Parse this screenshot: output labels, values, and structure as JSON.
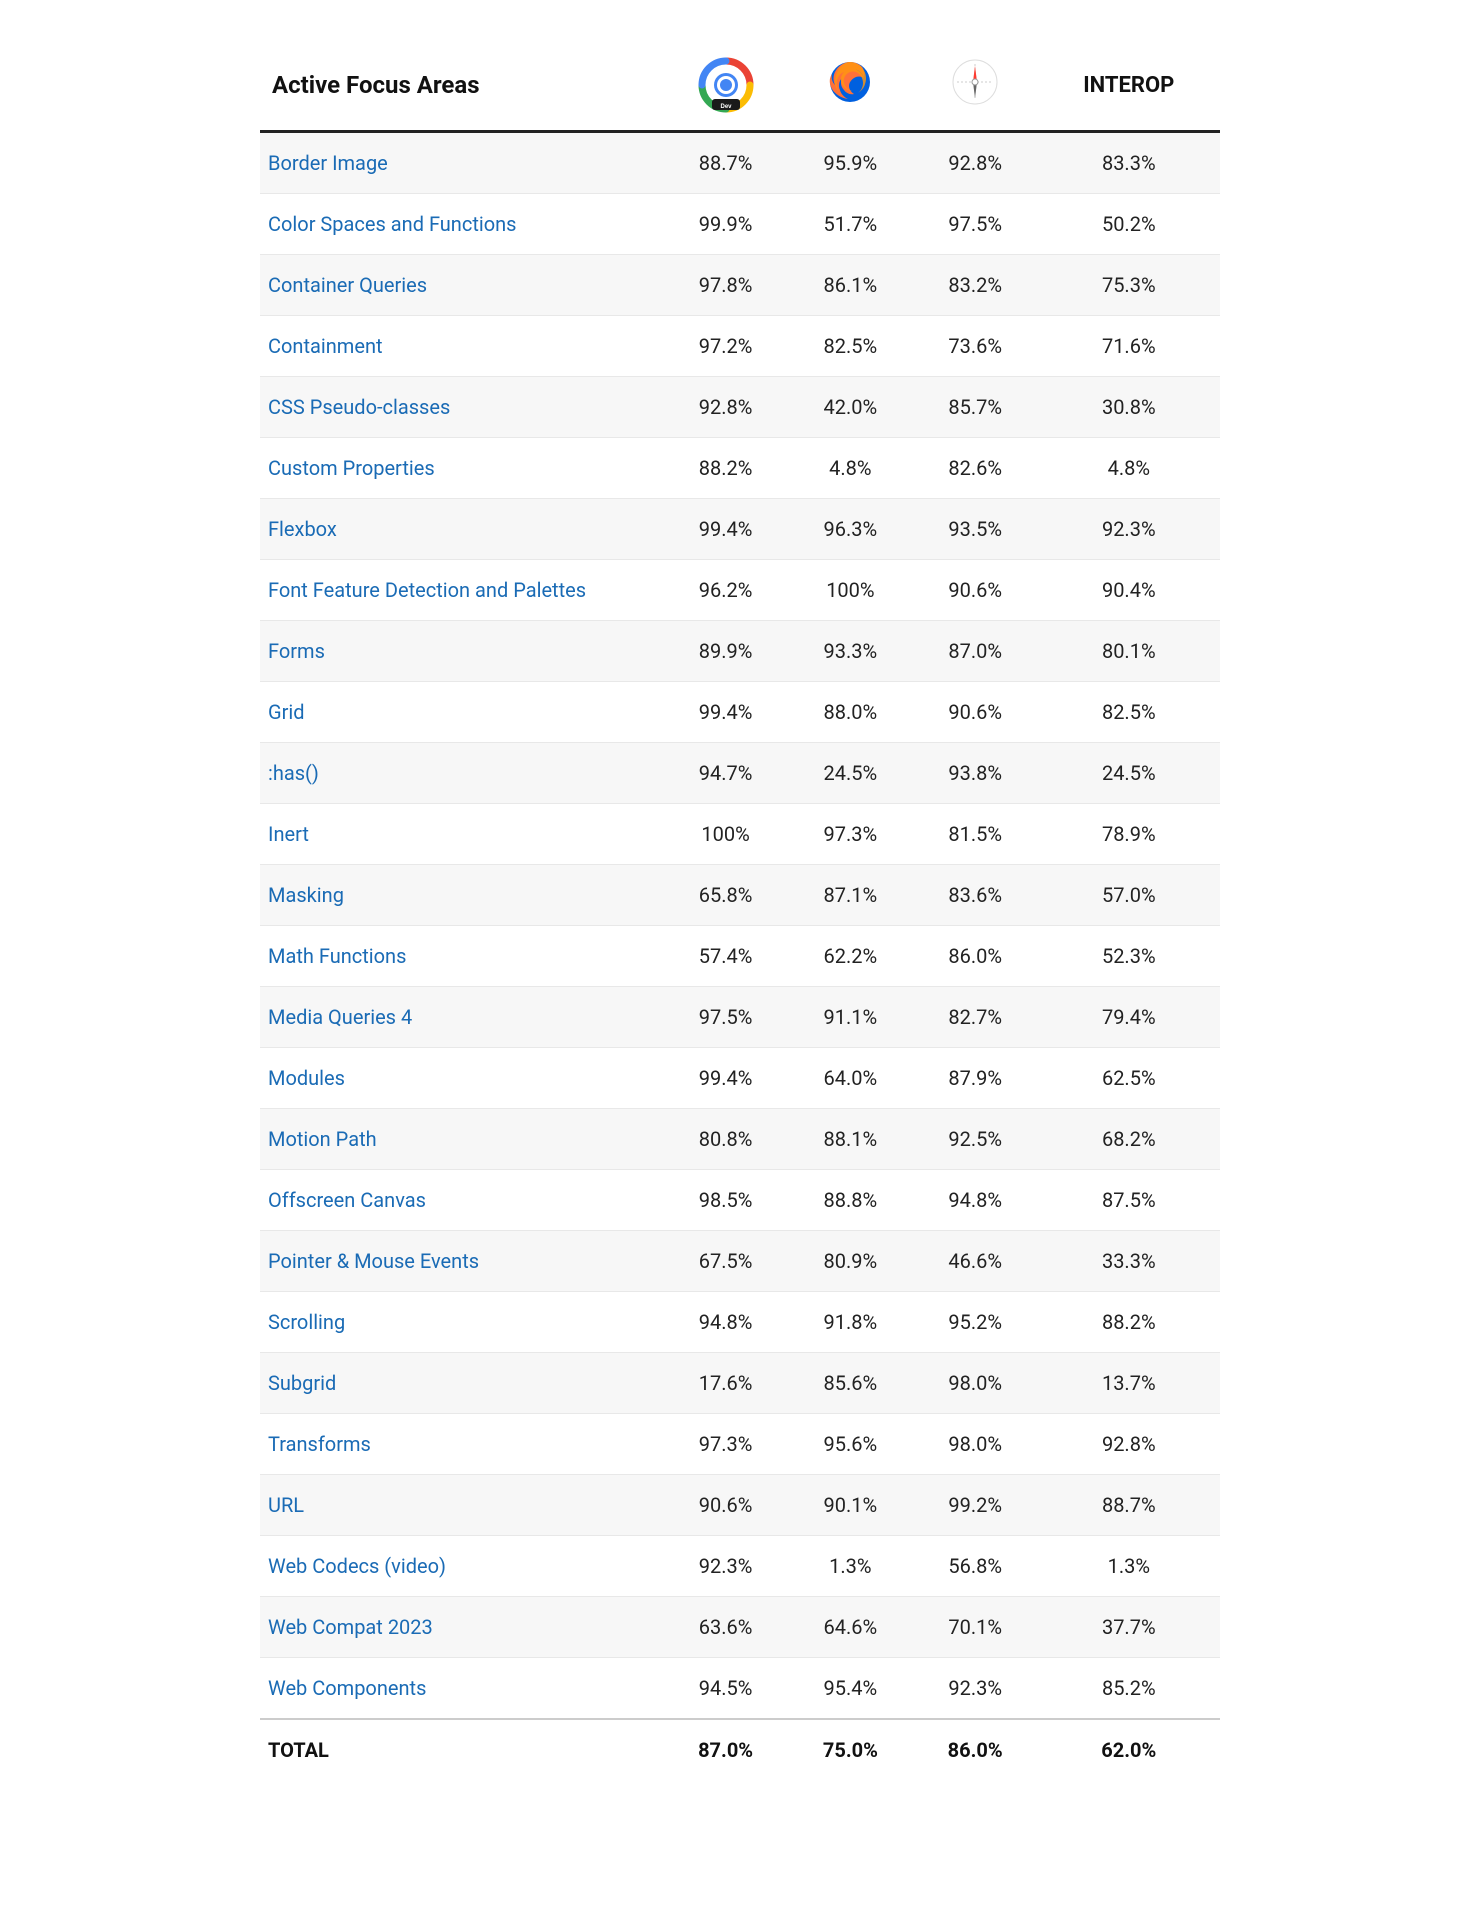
{
  "header": {
    "column1": "Active Focus Areas",
    "column4": "INTEROP"
  },
  "rows": [
    {
      "feature": "Border Image",
      "chrome": "88.7%",
      "firefox": "95.9%",
      "safari": "92.8%",
      "interop": "83.3%"
    },
    {
      "feature": "Color Spaces and Functions",
      "chrome": "99.9%",
      "firefox": "51.7%",
      "safari": "97.5%",
      "interop": "50.2%"
    },
    {
      "feature": "Container Queries",
      "chrome": "97.8%",
      "firefox": "86.1%",
      "safari": "83.2%",
      "interop": "75.3%"
    },
    {
      "feature": "Containment",
      "chrome": "97.2%",
      "firefox": "82.5%",
      "safari": "73.6%",
      "interop": "71.6%"
    },
    {
      "feature": "CSS Pseudo-classes",
      "chrome": "92.8%",
      "firefox": "42.0%",
      "safari": "85.7%",
      "interop": "30.8%"
    },
    {
      "feature": "Custom Properties",
      "chrome": "88.2%",
      "firefox": "4.8%",
      "safari": "82.6%",
      "interop": "4.8%"
    },
    {
      "feature": "Flexbox",
      "chrome": "99.4%",
      "firefox": "96.3%",
      "safari": "93.5%",
      "interop": "92.3%"
    },
    {
      "feature": "Font Feature Detection and Palettes",
      "chrome": "96.2%",
      "firefox": "100%",
      "safari": "90.6%",
      "interop": "90.4%"
    },
    {
      "feature": "Forms",
      "chrome": "89.9%",
      "firefox": "93.3%",
      "safari": "87.0%",
      "interop": "80.1%"
    },
    {
      "feature": "Grid",
      "chrome": "99.4%",
      "firefox": "88.0%",
      "safari": "90.6%",
      "interop": "82.5%"
    },
    {
      "feature": ":has()",
      "chrome": "94.7%",
      "firefox": "24.5%",
      "safari": "93.8%",
      "interop": "24.5%"
    },
    {
      "feature": "Inert",
      "chrome": "100%",
      "firefox": "97.3%",
      "safari": "81.5%",
      "interop": "78.9%"
    },
    {
      "feature": "Masking",
      "chrome": "65.8%",
      "firefox": "87.1%",
      "safari": "83.6%",
      "interop": "57.0%"
    },
    {
      "feature": "Math Functions",
      "chrome": "57.4%",
      "firefox": "62.2%",
      "safari": "86.0%",
      "interop": "52.3%"
    },
    {
      "feature": "Media Queries 4",
      "chrome": "97.5%",
      "firefox": "91.1%",
      "safari": "82.7%",
      "interop": "79.4%"
    },
    {
      "feature": "Modules",
      "chrome": "99.4%",
      "firefox": "64.0%",
      "safari": "87.9%",
      "interop": "62.5%"
    },
    {
      "feature": "Motion Path",
      "chrome": "80.8%",
      "firefox": "88.1%",
      "safari": "92.5%",
      "interop": "68.2%"
    },
    {
      "feature": "Offscreen Canvas",
      "chrome": "98.5%",
      "firefox": "88.8%",
      "safari": "94.8%",
      "interop": "87.5%"
    },
    {
      "feature": "Pointer & Mouse Events",
      "chrome": "67.5%",
      "firefox": "80.9%",
      "safari": "46.6%",
      "interop": "33.3%"
    },
    {
      "feature": "Scrolling",
      "chrome": "94.8%",
      "firefox": "91.8%",
      "safari": "95.2%",
      "interop": "88.2%"
    },
    {
      "feature": "Subgrid",
      "chrome": "17.6%",
      "firefox": "85.6%",
      "safari": "98.0%",
      "interop": "13.7%"
    },
    {
      "feature": "Transforms",
      "chrome": "97.3%",
      "firefox": "95.6%",
      "safari": "98.0%",
      "interop": "92.8%"
    },
    {
      "feature": "URL",
      "chrome": "90.6%",
      "firefox": "90.1%",
      "safari": "99.2%",
      "interop": "88.7%"
    },
    {
      "feature": "Web Codecs (video)",
      "chrome": "92.3%",
      "firefox": "1.3%",
      "safari": "56.8%",
      "interop": "1.3%"
    },
    {
      "feature": "Web Compat 2023",
      "chrome": "63.6%",
      "firefox": "64.6%",
      "safari": "70.1%",
      "interop": "37.7%"
    },
    {
      "feature": "Web Components",
      "chrome": "94.5%",
      "firefox": "95.4%",
      "safari": "92.3%",
      "interop": "85.2%"
    }
  ],
  "footer": {
    "label": "TOTAL",
    "chrome": "87.0%",
    "firefox": "75.0%",
    "safari": "86.0%",
    "interop": "62.0%"
  }
}
